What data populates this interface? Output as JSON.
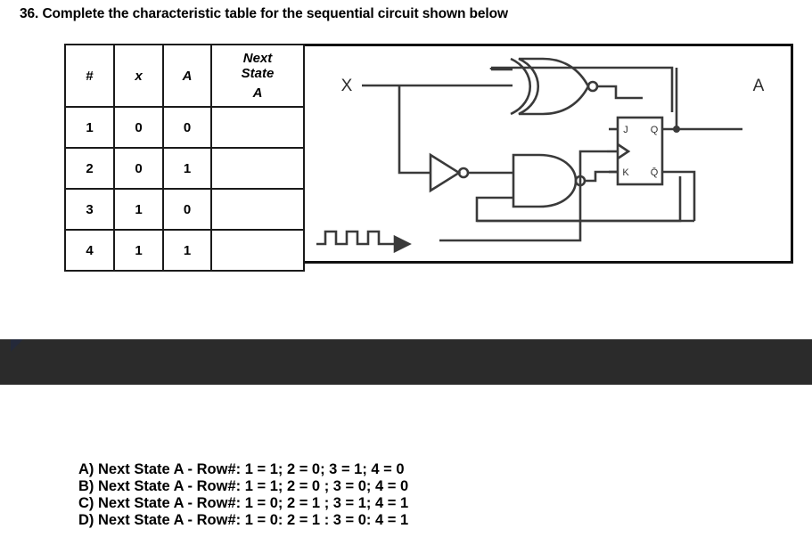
{
  "question": {
    "number": "36.",
    "text": "36. Complete the characteristic table for the sequential circuit shown below"
  },
  "table": {
    "headers": {
      "num": "#",
      "x": "x",
      "a": "A",
      "next_state_line1": "Next",
      "next_state_line2": "State",
      "next_state_line3": "A"
    },
    "rows": [
      {
        "num": "1",
        "x": "0",
        "a": "0",
        "next_state": ""
      },
      {
        "num": "2",
        "x": "0",
        "a": "1",
        "next_state": ""
      },
      {
        "num": "3",
        "x": "1",
        "a": "0",
        "next_state": ""
      },
      {
        "num": "4",
        "x": "1",
        "a": "1",
        "next_state": ""
      }
    ]
  },
  "circuit": {
    "input_label": "X",
    "output_label": "A",
    "flipflop": {
      "j_label": "J",
      "q_label": "Q",
      "k_label": "K",
      "qbar_label": "Q̄"
    },
    "gates": {
      "xnor": "xnor-gate",
      "inverter": "inverter-gate",
      "nand": "nand-gate"
    },
    "clock_label": "clock-waveform"
  },
  "answers": [
    "A) Next State A - Row#: 1 =  1; 2 = 0; 3 = 1;  4 = 0",
    "B) Next State A - Row#: 1 =  1; 2 = 0 ; 3 = 0; 4 = 0",
    "C) Next State A - Row#: 1 =  0; 2 = 1 ; 3 = 1; 4 = 1",
    "D) Next State A - Row#: 1 =  0: 2 = 1 : 3 = 0: 4 = 1"
  ],
  "colors": {
    "band": "#2b2b2b",
    "line": "#3a3a3a",
    "border": "#111111"
  }
}
